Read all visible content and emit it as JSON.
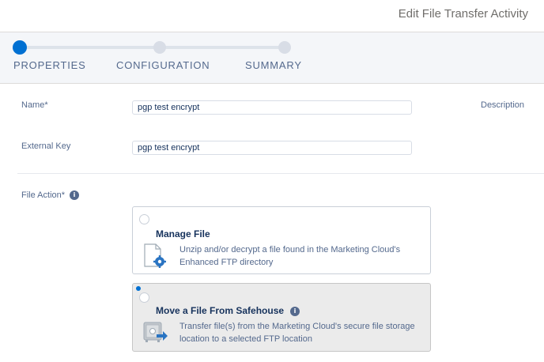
{
  "header": {
    "title": "Edit File Transfer Activity"
  },
  "steps": [
    {
      "label": "PROPERTIES",
      "active": true
    },
    {
      "label": "CONFIGURATION",
      "active": false
    },
    {
      "label": "SUMMARY",
      "active": false
    }
  ],
  "form": {
    "name_label": "Name*",
    "name_value": "pgp test encrypt",
    "description_label": "Description",
    "external_key_label": "External Key",
    "external_key_value": "pgp test encrypt",
    "file_action_label": "File Action*",
    "info_glyph": "i"
  },
  "options": [
    {
      "title": "Manage File",
      "description": "Unzip and/or decrypt a file found in the Marketing Cloud's Enhanced FTP directory",
      "icon": "file-gear-icon",
      "selected": false
    },
    {
      "title": "Move a File From Safehouse",
      "description": "Transfer file(s) from the Marketing Cloud's secure file storage location to a selected FTP location",
      "icon": "safe-move-icon",
      "selected": true
    }
  ],
  "colors": {
    "accent": "#0070d2",
    "label": "#54698d",
    "text": "#16325c"
  }
}
